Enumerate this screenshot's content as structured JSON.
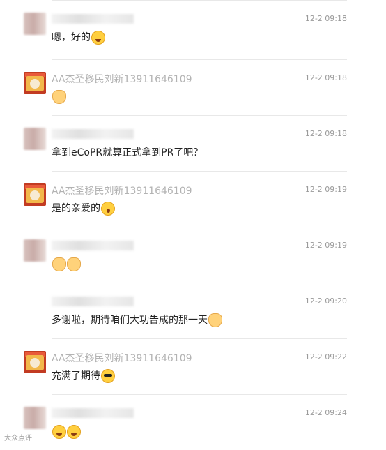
{
  "comments": [
    {
      "name": "",
      "time": "12-2 09:18",
      "text": "嗯，好的",
      "emojis": [
        "grin-emoji"
      ]
    },
    {
      "name": "AA杰圣移民刘新13911646109",
      "time": "12-2 09:18",
      "text": "",
      "emojis": [
        "victory-hand-emoji"
      ]
    },
    {
      "name": "",
      "time": "12-2 09:18",
      "text": "拿到eCoPR就算正式拿到PR了吧？",
      "emojis": []
    },
    {
      "name": "AA杰圣移民刘新13911646109",
      "time": "12-2 09:19",
      "text": "是的亲爱的",
      "emojis": [
        "surprised-emoji"
      ]
    },
    {
      "name": "",
      "time": "12-2 09:19",
      "text": "",
      "emojis": [
        "hug-emoji",
        "hug-emoji"
      ]
    },
    {
      "name": "",
      "time": "12-2 09:20",
      "text": "多谢啦，期待咱们大功告成的那一天",
      "emojis": [
        "fighting-emoji"
      ]
    },
    {
      "name": "AA杰圣移民刘新13911646109",
      "time": "12-2 09:22",
      "text": "充满了期待",
      "emojis": [
        "cool-emoji"
      ]
    },
    {
      "name": "",
      "time": "12-2 09:24",
      "text": "",
      "emojis": [
        "grin-emoji",
        "grin-emoji"
      ]
    }
  ],
  "watermark": "大众点评"
}
